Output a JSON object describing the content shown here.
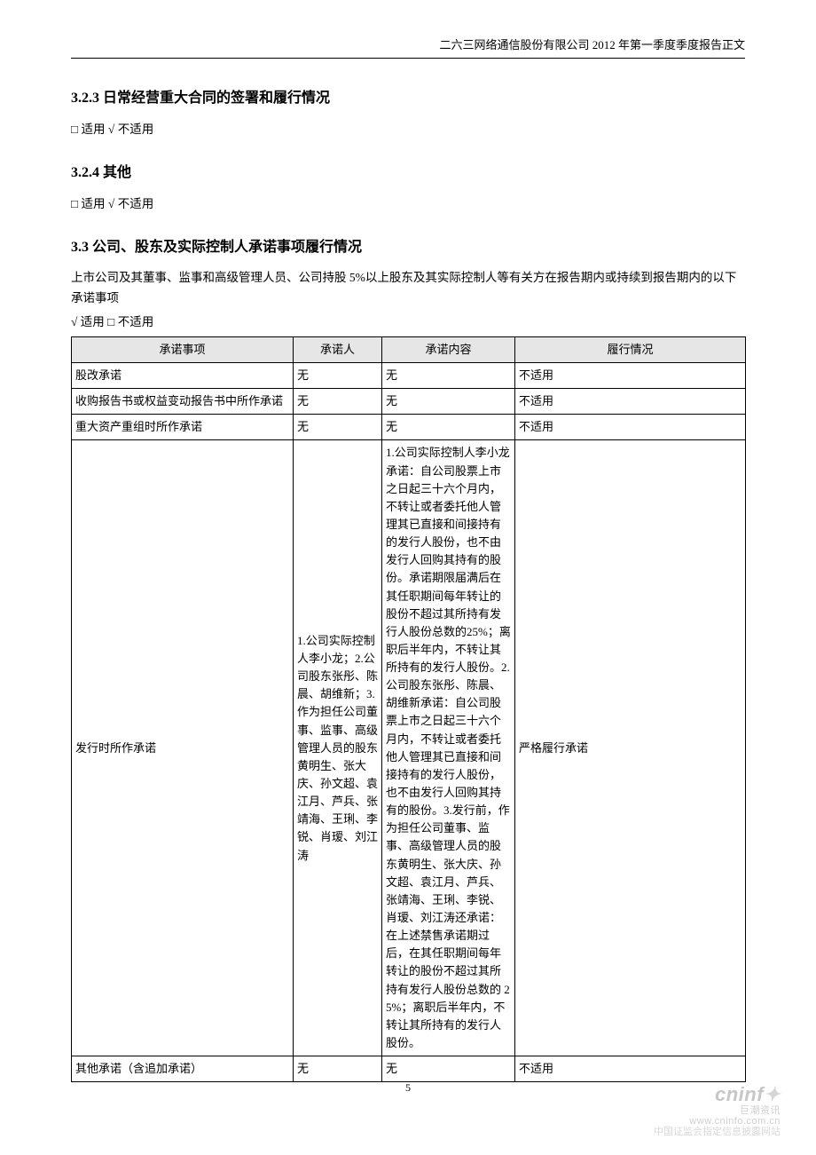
{
  "running_header": "二六三网络通信股份有限公司 2012 年第一季度季度报告正文",
  "sections": {
    "s323": {
      "heading": "3.2.3 日常经营重大合同的签署和履行情况",
      "applicable": "□ 适用 √ 不适用"
    },
    "s324": {
      "heading": "3.2.4 其他",
      "applicable": "□ 适用 √ 不适用"
    },
    "s33": {
      "heading": "3.3 公司、股东及实际控制人承诺事项履行情况",
      "intro": "上市公司及其董事、监事和高级管理人员、公司持股 5%以上股东及其实际控制人等有关方在报告期内或持续到报告期内的以下承诺事项",
      "applicable": "√ 适用 □ 不适用"
    }
  },
  "table": {
    "headers": {
      "item": "承诺事项",
      "party": "承诺人",
      "content": "承诺内容",
      "status": "履行情况"
    },
    "rows": [
      {
        "item": "股改承诺",
        "party": "无",
        "content": "无",
        "status": "不适用"
      },
      {
        "item": "收购报告书或权益变动报告书中所作承诺",
        "party": "无",
        "content": "无",
        "status": "不适用"
      },
      {
        "item": "重大资产重组时所作承诺",
        "party": "无",
        "content": "无",
        "status": "不适用"
      },
      {
        "item": "发行时所作承诺",
        "party": "1.公司实际控制人李小龙；2.公司股东张彤、陈晨、胡维新；3. 作为担任公司董事、监事、高级管理人员的股东黄明生、张大庆、孙文超、袁江月、芦兵、张靖海、王琍、李锐、肖瑷、刘江涛",
        "content": "1.公司实际控制人李小龙承诺：自公司股票上市之日起三十六个月内，不转让或者委托他人管理其已直接和间接持有的发行人股份，也不由发行人回购其持有的股份。承诺期限届满后在其任职期间每年转让的股份不超过其所持有发行人股份总数的25%；离职后半年内，不转让其所持有的发行人股份。2.公司股东张彤、陈晨、胡维新承诺：自公司股票上市之日起三十六个月内，不转让或者委托他人管理其已直接和间接持有的发行人股份，也不由发行人回购其持有的股份。3.发行前，作为担任公司董事、监事、高级管理人员的股东黄明生、张大庆、孙文超、袁江月、芦兵、张靖海、王琍、李锐、肖瑷、刘江涛还承诺：在上述禁售承诺期过后，在其任职期间每年转让的股份不超过其所持有发行人股份总数的 25%；离职后半年内，不转让其所持有的发行人股份。",
        "status": "严格履行承诺"
      },
      {
        "item": "其他承诺（含追加承诺）",
        "party": "无",
        "content": "无",
        "status": "不适用"
      }
    ]
  },
  "page_number": "5",
  "watermark": {
    "brand": "cninf",
    "zh": "巨潮资讯",
    "url": "www.cninfo.com.cn",
    "desc": "中国证监会指定信息披露网站"
  }
}
